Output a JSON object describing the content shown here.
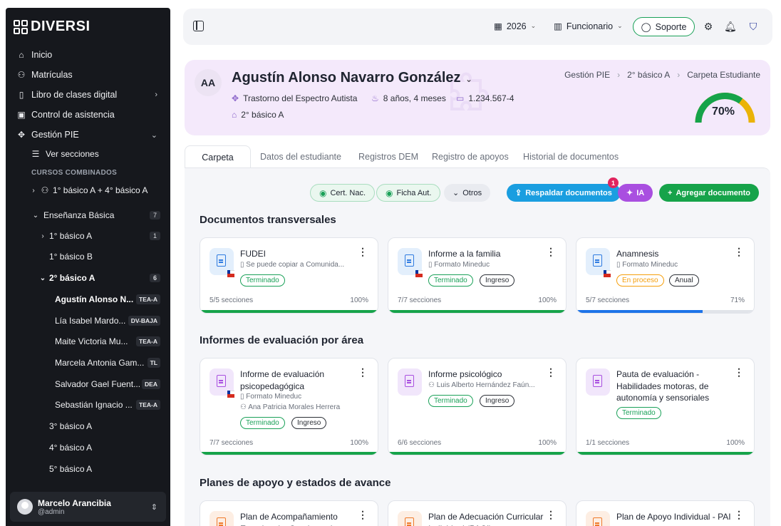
{
  "sidebar": {
    "logo": "DIVERSI",
    "nav": [
      {
        "label": "Inicio",
        "icon": "home-icon"
      },
      {
        "label": "Matrículas",
        "icon": "user-plus-icon"
      },
      {
        "label": "Libro de clases digital",
        "icon": "book-icon"
      },
      {
        "label": "Control de asistencia",
        "icon": "clipboard-check-icon"
      },
      {
        "label": "Gestión PIE",
        "icon": "puzzle-icon"
      },
      {
        "label": "Ver secciones",
        "icon": "list-icon"
      }
    ],
    "section_header": "CURSOS COMBINADOS",
    "combined_course": "1° básico A + 4° básico A",
    "group": {
      "label": "Enseñanza Básica",
      "count": "7"
    },
    "courses": [
      {
        "label": "1° básico A",
        "count": "1"
      },
      {
        "label": "1° básico B"
      },
      {
        "label": "2° básico A",
        "count": "6"
      }
    ],
    "students": [
      {
        "name": "Agustín Alonso N...",
        "tag": "TEA-A"
      },
      {
        "name": "Lía Isabel Mardo...",
        "tag": "DV-BAJA"
      },
      {
        "name": "Maite Victoria Mu...",
        "tag": "TEA-A"
      },
      {
        "name": "Marcela Antonia Gam...",
        "tag": "TL"
      },
      {
        "name": "Salvador Gael Fuent...",
        "tag": "DEA"
      },
      {
        "name": "Sebastián Ignacio ...",
        "tag": "TEA-A"
      }
    ],
    "more_courses": [
      "3° básico A",
      "4° básico A",
      "5° básico A"
    ],
    "user": {
      "name": "Marcelo Arancibia",
      "handle": "@admin"
    }
  },
  "topbar": {
    "year": "2026",
    "role": "Funcionario",
    "support": "Soporte"
  },
  "student": {
    "initials": "AA",
    "name": "Agustín Alonso Navarro González",
    "diagnosis": "Trastorno del Espectro Autista",
    "age": "8 años, 4 meses",
    "rut": "1.234.567-4",
    "course": "2° básico A",
    "progress_label": "70%",
    "progress": 0.7
  },
  "breadcrumb": [
    "Gestión PIE",
    "2° básico A",
    "Carpeta Estudiante"
  ],
  "tabs": [
    "Carpeta",
    "Datos del estudiante",
    "Registros DEM",
    "Registro de apoyos",
    "Historial de documentos"
  ],
  "actions": {
    "cert": "Cert. Nac.",
    "ficha": "Ficha Aut.",
    "otros": "Otros",
    "respaldar": "Respaldar documentos",
    "respaldar_badge": "1",
    "ia": "IA",
    "agregar": "Agregar documento"
  },
  "sections": {
    "transversales": "Documentos transversales",
    "evaluacion": "Informes de evaluación por área",
    "planes": "Planes de apoyo y estados de avance"
  },
  "cards_row1": [
    {
      "title": "FUDEI",
      "sub": "Se puede copiar a Comunida...",
      "tags": [
        "Terminado"
      ],
      "foot": "5/5 secciones",
      "pct": "100%",
      "progress": 1.0
    },
    {
      "title": "Informe a la familia",
      "sub": "Formato Mineduc",
      "tags": [
        "Terminado",
        "Ingreso"
      ],
      "foot": "7/7 secciones",
      "pct": "100%",
      "progress": 1.0
    },
    {
      "title": "Anamnesis",
      "sub": "Formato Mineduc",
      "tags": [
        "En proceso",
        "Anual"
      ],
      "foot": "5/7 secciones",
      "pct": "71%",
      "progress": 0.71
    }
  ],
  "cards_row2": [
    {
      "title": "Informe de evaluación psicopedagógica",
      "sub": "Formato Mineduc",
      "sub2": "Ana Patricia Morales Herrera",
      "tags": [
        "Terminado",
        "Ingreso"
      ],
      "foot": "7/7 secciones",
      "pct": "100%",
      "progress": 1.0
    },
    {
      "title": "Informe psicológico",
      "sub": "Luis Alberto Hernández Faún...",
      "tags": [
        "Terminado",
        "Ingreso"
      ],
      "foot": "6/6 secciones",
      "pct": "100%",
      "progress": 1.0
    },
    {
      "title": "Pauta de evaluación - Habilidades motoras, de autonomía y sensoriales",
      "tags": [
        "Terminado"
      ],
      "foot": "1/1 secciones",
      "pct": "100%",
      "progress": 1.0
    }
  ],
  "cards_row3": [
    {
      "title": "Plan de Acompañamiento Emocional y Conductual"
    },
    {
      "title": "Plan de Adecuación Curricular Individual (PACI)"
    },
    {
      "title": "Plan de Apoyo Individual - PAI"
    }
  ],
  "colors": {
    "accent_green": "#16a34a",
    "accent_blue": "#1a9ee0",
    "accent_purple": "#a94fe0",
    "header_bg": "#f4e9fb"
  }
}
